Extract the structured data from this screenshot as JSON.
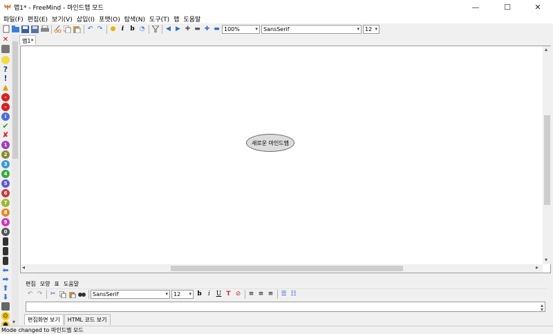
{
  "window": {
    "title": "맵1* - FreeMind - 마인드맵 모드",
    "minimize": "—",
    "maximize": "☐",
    "close": "✕"
  },
  "menu": [
    "파일(F)",
    "편집(E)",
    "보기(V)",
    "삽입(I)",
    "포맷(O)",
    "탐색(N)",
    "도구(T)",
    "맵",
    "도움말"
  ],
  "toolbar": {
    "zoom": "100%",
    "font": "SansSerif",
    "size": "12"
  },
  "tab": {
    "label": "맵1*"
  },
  "map": {
    "root_node": "새로운 마인드맵"
  },
  "note_editor": {
    "menu": [
      "편집",
      "모양",
      "표",
      "도움말"
    ],
    "font": "SansSerif",
    "size": "12",
    "view_tabs": [
      "편집화면 보기",
      "HTML 코드 보기"
    ]
  },
  "status": {
    "text": "Mode changed to 마인드맵 모드"
  },
  "colors": {
    "accent": "#c03030",
    "node_fill": "#dcdcdc"
  }
}
